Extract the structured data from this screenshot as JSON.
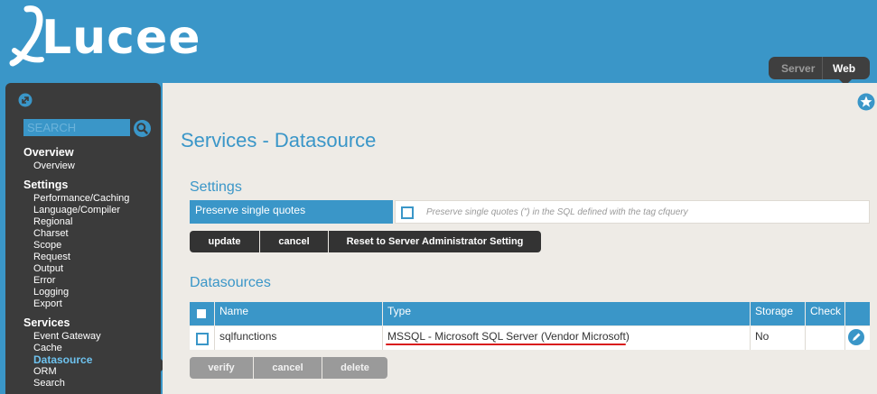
{
  "header": {
    "logo_text": "Lucee",
    "mode_tabs": [
      {
        "label": "Server",
        "active": false
      },
      {
        "label": "Web",
        "active": true
      }
    ]
  },
  "sidebar": {
    "search_placeholder": "SEARCH",
    "sections": [
      {
        "title": "Overview",
        "items": [
          "Overview"
        ]
      },
      {
        "title": "Settings",
        "items": [
          "Performance/Caching",
          "Language/Compiler",
          "Regional",
          "Charset",
          "Scope",
          "Request",
          "Output",
          "Error",
          "Logging",
          "Export"
        ]
      },
      {
        "title": "Services",
        "items": [
          "Event Gateway",
          "Cache",
          "Datasource",
          "ORM",
          "Search"
        ],
        "active_item": "Datasource"
      }
    ]
  },
  "main": {
    "page_title": "Services - Datasource",
    "settings": {
      "title": "Settings",
      "preserve_label": "Preserve single quotes",
      "preserve_description": "Preserve single quotes (\") in the SQL defined with the tag cfquery",
      "preserve_checked": false,
      "buttons": {
        "update": "update",
        "cancel": "cancel",
        "reset": "Reset to Server Administrator Setting"
      }
    },
    "datasources": {
      "title": "Datasources",
      "columns": [
        "Name",
        "Type",
        "Storage",
        "Check"
      ],
      "rows": [
        {
          "name": "sqlfunctions",
          "type": "MSSQL - Microsoft SQL Server (Vendor Microsoft)",
          "storage": "No",
          "check": ""
        }
      ],
      "buttons": {
        "verify": "verify",
        "cancel": "cancel",
        "delete": "delete"
      }
    }
  },
  "colors": {
    "brand_blue": "#3a96c8",
    "dark": "#3b3b3b",
    "panel_bg": "#eeebe6",
    "annotation_red": "#d91d1d"
  },
  "icons": [
    "collapse-icon",
    "search-icon",
    "star-icon",
    "edit-pencil-icon",
    "checkbox-icon"
  ]
}
